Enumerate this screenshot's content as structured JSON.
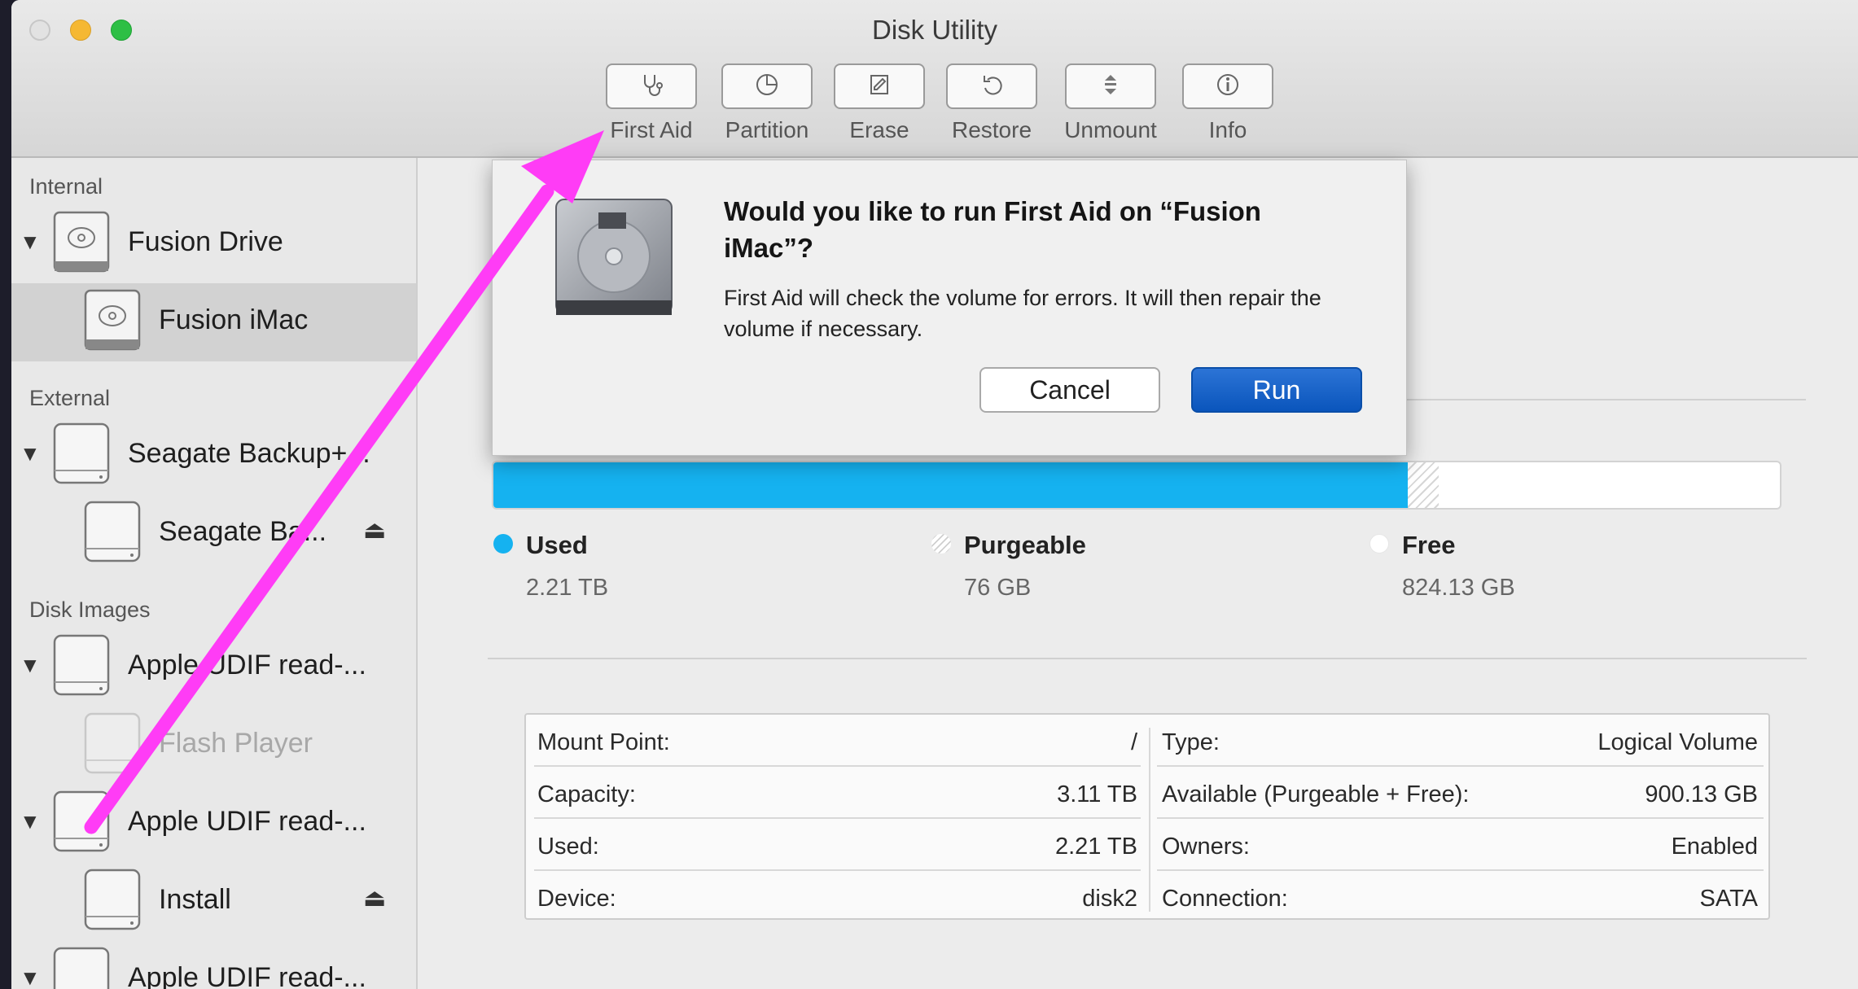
{
  "window": {
    "title": "Disk Utility"
  },
  "toolbar": {
    "buttons": [
      {
        "label": "First Aid",
        "icon": "stethoscope-icon"
      },
      {
        "label": "Partition",
        "icon": "pie-chart-icon"
      },
      {
        "label": "Erase",
        "icon": "eraser-icon"
      },
      {
        "label": "Restore",
        "icon": "restore-arrow-icon"
      },
      {
        "label": "Unmount",
        "icon": "unmount-icon"
      },
      {
        "label": "Info",
        "icon": "info-icon"
      }
    ]
  },
  "sidebar": {
    "sections": [
      {
        "title": "Internal"
      },
      {
        "title": "External"
      },
      {
        "title": "Disk Images"
      }
    ],
    "items": [
      {
        "label": "Fusion Drive"
      },
      {
        "label": "Fusion iMac"
      },
      {
        "label": "Seagate Backup+..."
      },
      {
        "label": "Seagate Ba..."
      },
      {
        "label": "Apple UDIF read-..."
      },
      {
        "label": "Flash Player"
      },
      {
        "label": "Apple UDIF read-..."
      },
      {
        "label": "Install"
      },
      {
        "label": "Apple UDIF read-..."
      }
    ],
    "eject_symbol": "⏏"
  },
  "dialog": {
    "title": "Would you like to run First Aid on “Fusion iMac”?",
    "body": "First Aid will check the volume for errors. It will then repair the volume if necessary.",
    "cancel_label": "Cancel",
    "run_label": "Run"
  },
  "usage": {
    "used_fraction": 0.711,
    "purgeable_fraction": 0.024,
    "colors": {
      "used": "#15b2f0",
      "free": "#ffffff",
      "accent_button": "#0a55bc",
      "annotation_arrow": "#ff3cf6"
    },
    "legend": [
      {
        "title": "Used",
        "value": "2.21 TB"
      },
      {
        "title": "Purgeable",
        "value": "76 GB"
      },
      {
        "title": "Free",
        "value": "824.13 GB"
      }
    ]
  },
  "info": {
    "left": [
      {
        "key": "Mount Point:",
        "value": "/"
      },
      {
        "key": "Capacity:",
        "value": "3.11 TB"
      },
      {
        "key": "Used:",
        "value": "2.21 TB"
      },
      {
        "key": "Device:",
        "value": "disk2"
      }
    ],
    "right": [
      {
        "key": "Type:",
        "value": "Logical Volume"
      },
      {
        "key": "Available (Purgeable + Free):",
        "value": "900.13 GB"
      },
      {
        "key": "Owners:",
        "value": "Enabled"
      },
      {
        "key": "Connection:",
        "value": "SATA"
      }
    ]
  }
}
